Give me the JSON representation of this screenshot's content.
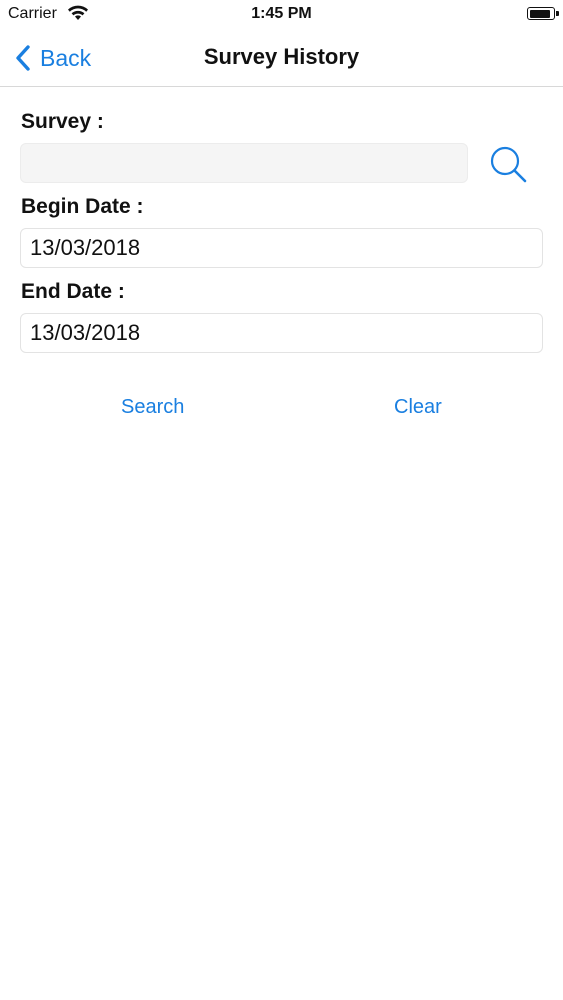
{
  "status_bar": {
    "carrier": "Carrier",
    "time": "1:45 PM",
    "wifi_icon": "wifi-icon",
    "battery_icon": "battery-icon",
    "battery_level": 0.9
  },
  "nav": {
    "back_label": "Back",
    "back_icon": "chevron-left-icon",
    "title": "Survey History"
  },
  "form": {
    "survey": {
      "label": "Survey :",
      "value": "",
      "search_icon": "magnifier-icon"
    },
    "begin_date": {
      "label": "Begin Date :",
      "value": "13/03/2018"
    },
    "end_date": {
      "label": "End Date :",
      "value": "13/03/2018"
    }
  },
  "actions": {
    "search_label": "Search",
    "clear_label": "Clear"
  },
  "colors": {
    "accent": "#1a7fe0",
    "text": "#111111",
    "field_border": "#e3e3e3",
    "survey_field_bg": "#f5f5f5"
  }
}
